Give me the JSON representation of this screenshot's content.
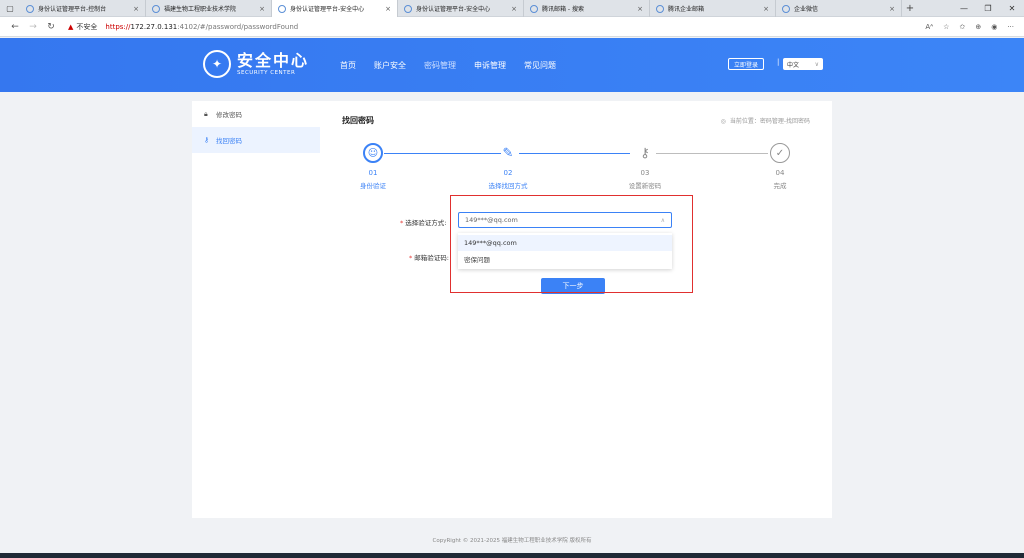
{
  "browser": {
    "tabs": [
      {
        "title": "身份认证管理平台-控制台",
        "active": false
      },
      {
        "title": "福建生物工程职业技术学院",
        "active": false
      },
      {
        "title": "身份认证管理平台-安全中心",
        "active": true
      },
      {
        "title": "身份认证管理平台-安全中心",
        "active": false
      },
      {
        "title": "腾讯邮箱 - 搜索",
        "active": false
      },
      {
        "title": "腾讯企业邮箱",
        "active": false
      },
      {
        "title": "企业微信",
        "active": false
      }
    ],
    "insecure_label": "不安全",
    "url_proto": "https://",
    "url_host": "172.27.0.131",
    "url_path": ":4102/#/password/passwordFound"
  },
  "site": {
    "logo_cn": "安全中心",
    "logo_en": "SECURITY CENTER",
    "nav": [
      "首页",
      "账户安全",
      "密码管理",
      "申诉管理",
      "常见问题"
    ],
    "active_nav_index": 2,
    "login_label": "立即登录",
    "separator": "|",
    "language": "中文"
  },
  "sidebar": {
    "items": [
      {
        "label": "修改密码",
        "icon": "lock-icon",
        "active": false
      },
      {
        "label": "找回密码",
        "icon": "key-icon",
        "active": true
      }
    ]
  },
  "main": {
    "title": "找回密码",
    "breadcrumb": "当前位置：密码管理-找回密码",
    "steps": [
      {
        "num": "01",
        "label": "身份验证",
        "icon": "user-circle-icon",
        "state": "done"
      },
      {
        "num": "02",
        "label": "选择找回方式",
        "icon": "edit-icon",
        "state": "done"
      },
      {
        "num": "03",
        "label": "设置新密码",
        "icon": "key-icon",
        "state": "todo"
      },
      {
        "num": "04",
        "label": "完成",
        "icon": "check-circle-icon",
        "state": "todo"
      }
    ],
    "form": {
      "method_label": "选择验证方式:",
      "method_value": "149***@qq.com",
      "options": [
        "149***@qq.com",
        "密保问题"
      ],
      "code_label": "邮箱验证码:",
      "next_label": "下一步"
    }
  },
  "footer": "CopyRight © 2021-2025 福建生物工程职业技术学院 版权所有",
  "colors": {
    "accent": "#3b82f6",
    "highlight": "#e0302f"
  }
}
